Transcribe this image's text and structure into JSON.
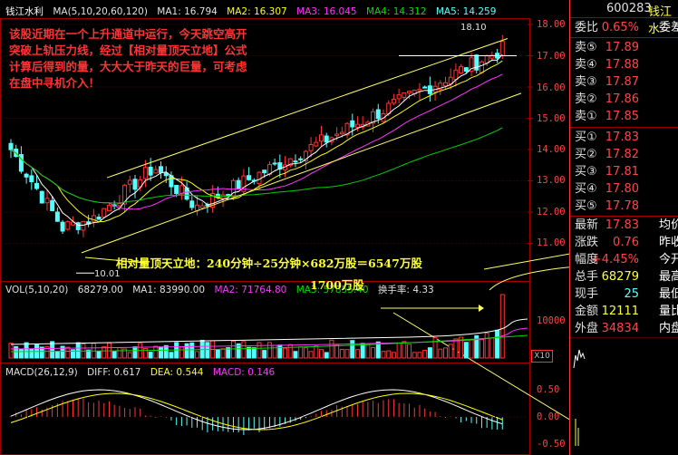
{
  "header": {
    "stock_name": "钱江水利",
    "ma_label": "MA(5,10,20,60,120)",
    "ma1": "MA1: 16.794",
    "ma2": "MA2: 16.307",
    "ma3": "MA3: 16.045",
    "ma4": "MA4: 14.312",
    "ma5": "MA5: 14.259"
  },
  "price_axis": [
    "18.00",
    "17.00",
    "16.00",
    "15.00",
    "14.00",
    "13.00",
    "12.00",
    "11.00"
  ],
  "high_label": "18.10",
  "low_label": "10.01",
  "annotation": "该股近期在一个上升通道中运行，今天跳空高开\n突破上轨压力线，经过【相对量顶天立地】公式\n计算后得到的量，大大大于昨天的巨量，可考虑\n在盘中寻机介入！",
  "formula": "相对量顶天立地：240分钟÷25分钟×682万股＝6547万股",
  "vol_header": {
    "label": "VOL(5,10,20)",
    "vol": "68279.00",
    "ma1": "MA1: 83990.00",
    "ma2": "MA2: 71764.80",
    "ma3": "MA3: 57855.40",
    "turnover": "换手率: 4.33"
  },
  "vol_annotation": "1700万股",
  "vol_axis": "10000",
  "vol_unit": "X10",
  "macd_header": {
    "label": "MACD(26,12,9)",
    "diff": "DIFF: 0.617",
    "dea": "DEA: 0.544",
    "macd": "MACD: 0.146"
  },
  "macd_axis": [
    "0.50",
    "0.00",
    "-0.50"
  ],
  "panel": {
    "code": "600283",
    "name": "钱江水",
    "wei_bi": {
      "label": "委比",
      "value": "0.65%",
      "extra": "委差"
    },
    "sells": [
      {
        "label": "卖⑤",
        "price": "17.89"
      },
      {
        "label": "卖④",
        "price": "17.88"
      },
      {
        "label": "卖③",
        "price": "17.87"
      },
      {
        "label": "卖②",
        "price": "17.86"
      },
      {
        "label": "卖①",
        "price": "17.85"
      }
    ],
    "buys": [
      {
        "label": "买①",
        "price": "17.83"
      },
      {
        "label": "买②",
        "price": "17.82"
      },
      {
        "label": "买③",
        "price": "17.81"
      },
      {
        "label": "买④",
        "price": "17.80"
      },
      {
        "label": "买⑤",
        "price": "17.78"
      }
    ],
    "stats": [
      {
        "label": "最新",
        "value": "17.83",
        "extra": "均价"
      },
      {
        "label": "涨跌",
        "value": "0.76",
        "extra": "昨收"
      },
      {
        "label": "幅度",
        "value": "+4.45%",
        "extra": "今开"
      },
      {
        "label": "总手",
        "value": "68279",
        "extra": "最高"
      },
      {
        "label": "现手",
        "value": "25",
        "extra": "最低"
      },
      {
        "label": "金额",
        "value": "12111",
        "extra": "量比"
      },
      {
        "label": "外盘",
        "value": "34834",
        "extra": "内盘"
      }
    ]
  },
  "colors": {
    "up": "#ff3333",
    "down": "#55ffff",
    "ma1": "#ffffff",
    "ma2": "#ffff00",
    "ma3": "#ff33ff",
    "ma4": "#00cc00",
    "ma5": "#00cccc"
  }
}
